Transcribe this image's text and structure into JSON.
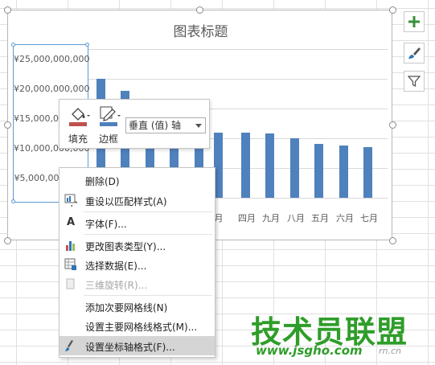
{
  "chart": {
    "title": "图表标题",
    "y_ticks": [
      "¥25,000,000,000",
      "¥20,000,000,000",
      "¥15,000,000,000",
      "¥10,000,000,000",
      "¥5,000,000,000"
    ],
    "x_ticks": [
      "月",
      "四月",
      "九月",
      "八月",
      "五月",
      "六月",
      "七月"
    ],
    "bar_color": "#4f81bd"
  },
  "chart_data": {
    "type": "bar",
    "title": "图表标题",
    "ylim": [
      0,
      25000000000
    ],
    "categories": [
      "",
      "",
      "",
      "",
      "",
      "月",
      "四月",
      "九月",
      "八月",
      "五月",
      "六月",
      "七月"
    ],
    "values": [
      20000000000,
      18000000000,
      11000000000,
      11000000000,
      11000000000,
      11000000000,
      11000000000,
      10800000000,
      10000000000,
      9000000000,
      8800000000,
      8500000000
    ]
  },
  "side_buttons": [
    {
      "icon": "plus-icon"
    },
    {
      "icon": "brush-icon"
    },
    {
      "icon": "filter-icon"
    }
  ],
  "mini_toolbar": {
    "fill_label": "填充",
    "border_label": "边框",
    "element_select_value": "垂直 (值) 轴",
    "fill_color": "#c0504d",
    "border_color": "#4f81bd"
  },
  "context_menu": {
    "items": [
      {
        "label": "删除(D)",
        "icon": "",
        "disabled": false
      },
      {
        "label": "重设以匹配样式(A)",
        "icon": "reset-style-icon",
        "disabled": false
      },
      {
        "label": "字体(F)...",
        "icon": "font-icon",
        "disabled": false
      },
      {
        "label": "更改图表类型(Y)...",
        "icon": "chart-type-icon",
        "disabled": false
      },
      {
        "label": "选择数据(E)...",
        "icon": "select-data-icon",
        "disabled": false
      },
      {
        "label": "三维旋转(R)...",
        "icon": "rotate-3d-icon",
        "disabled": true
      },
      {
        "label": "添加次要网格线(N)",
        "icon": "",
        "disabled": false
      },
      {
        "label": "设置主要网格线格式(M)...",
        "icon": "",
        "disabled": false
      },
      {
        "label": "设置坐标轴格式(F)...",
        "icon": "format-axis-icon",
        "disabled": false
      }
    ]
  },
  "watermark": {
    "text": "技术员联盟",
    "url": "www.jsgho.com",
    "url_suffix": "rn.cn"
  }
}
